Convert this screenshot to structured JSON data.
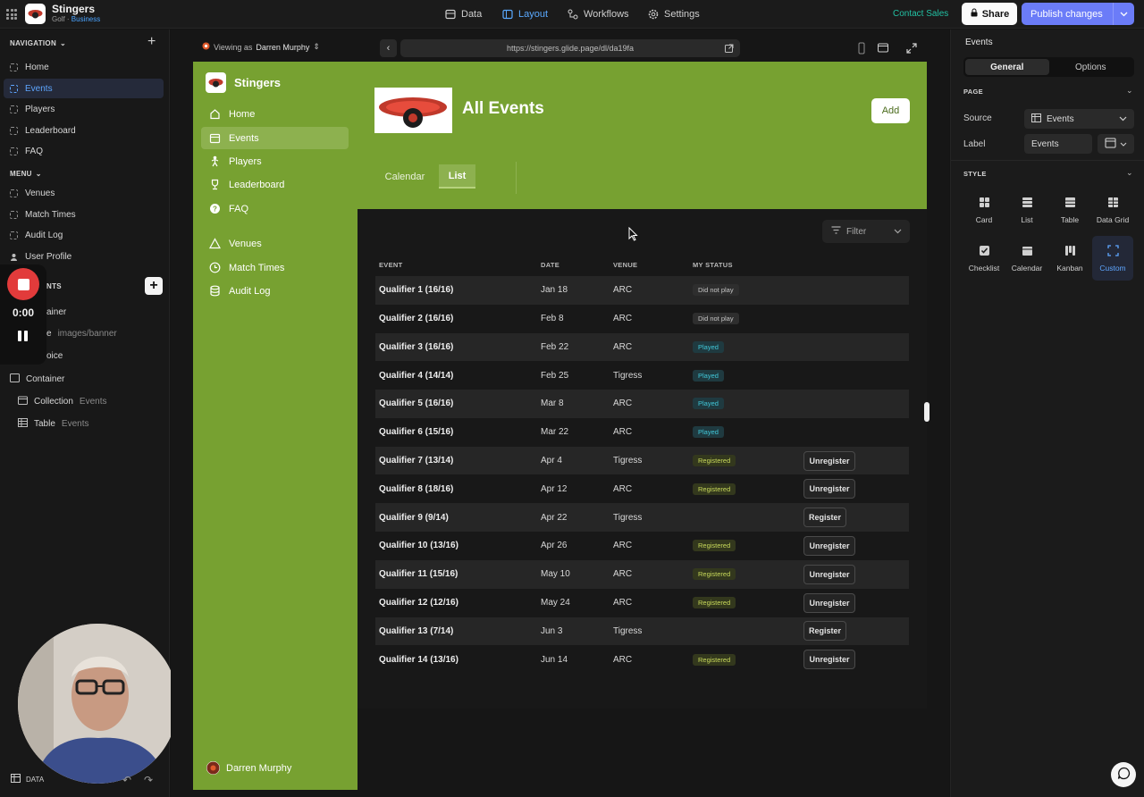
{
  "topbar": {
    "app_name": "Stingers",
    "app_sub": "Golf",
    "app_sub_sep": " · ",
    "app_tier": "Business",
    "nav": [
      {
        "label": "Data",
        "icon": "database-icon"
      },
      {
        "label": "Layout",
        "icon": "layout-icon",
        "active": true
      },
      {
        "label": "Workflows",
        "icon": "workflow-icon"
      },
      {
        "label": "Settings",
        "icon": "gear-icon"
      }
    ],
    "contact": "Contact Sales",
    "share": "Share",
    "publish": "Publish changes"
  },
  "left": {
    "navigation_title": "NAVIGATION",
    "navigation_items": [
      "Home",
      "Events",
      "Players",
      "Leaderboard",
      "FAQ"
    ],
    "selected": "Events",
    "menu_title": "MENU",
    "menu_items": [
      "Venues",
      "Match Times",
      "Audit Log",
      "User Profile"
    ],
    "components_title": "NTS",
    "components": [
      {
        "label": "ainer",
        "sub": ""
      },
      {
        "label": "e",
        "sub": "images/banner"
      },
      {
        "label": "oice",
        "sub": ""
      },
      {
        "label": "Container",
        "sub": ""
      },
      {
        "label": "Collection",
        "sub": "Events"
      },
      {
        "label": "Table",
        "sub": "Events"
      }
    ],
    "recording_time": "0:00",
    "data_tab": "DATA"
  },
  "preview": {
    "viewing_as_prefix": "Viewing as",
    "viewing_as": "Darren Murphy",
    "url": "https://stingers.glide.page/dl/da19fa",
    "app_title": "Stingers",
    "side_links": [
      "Home",
      "Events",
      "Players",
      "Leaderboard",
      "FAQ",
      "Venues",
      "Match Times",
      "Audit Log"
    ],
    "user": "Darren Murphy",
    "page_title": "All Events",
    "add": "Add",
    "tabs": [
      "Calendar",
      "List"
    ],
    "filter": "Filter",
    "columns": [
      "EVENT",
      "DATE",
      "VENUE",
      "MY STATUS"
    ],
    "rows": [
      {
        "event": "Qualifier 1 (16/16)",
        "date": "Jan 18",
        "venue": "ARC",
        "status": "Did not play",
        "action": ""
      },
      {
        "event": "Qualifier 2 (16/16)",
        "date": "Feb 8",
        "venue": "ARC",
        "status": "Did not play",
        "action": ""
      },
      {
        "event": "Qualifier 3 (16/16)",
        "date": "Feb 22",
        "venue": "ARC",
        "status": "Played",
        "action": ""
      },
      {
        "event": "Qualifier 4 (14/14)",
        "date": "Feb 25",
        "venue": "Tigress",
        "status": "Played",
        "action": ""
      },
      {
        "event": "Qualifier 5 (16/16)",
        "date": "Mar 8",
        "venue": "ARC",
        "status": "Played",
        "action": ""
      },
      {
        "event": "Qualifier 6 (15/16)",
        "date": "Mar 22",
        "venue": "ARC",
        "status": "Played",
        "action": ""
      },
      {
        "event": "Qualifier 7 (13/14)",
        "date": "Apr 4",
        "venue": "Tigress",
        "status": "Registered",
        "action": "Unregister"
      },
      {
        "event": "Qualifier 8 (18/16)",
        "date": "Apr 12",
        "venue": "ARC",
        "status": "Registered",
        "action": "Unregister"
      },
      {
        "event": "Qualifier 9 (9/14)",
        "date": "Apr 22",
        "venue": "Tigress",
        "status": "",
        "action": "Register"
      },
      {
        "event": "Qualifier 10 (13/16)",
        "date": "Apr 26",
        "venue": "ARC",
        "status": "Registered",
        "action": "Unregister"
      },
      {
        "event": "Qualifier 11 (15/16)",
        "date": "May 10",
        "venue": "ARC",
        "status": "Registered",
        "action": "Unregister"
      },
      {
        "event": "Qualifier 12 (12/16)",
        "date": "May 24",
        "venue": "ARC",
        "status": "Registered",
        "action": "Unregister"
      },
      {
        "event": "Qualifier 13 (7/14)",
        "date": "Jun 3",
        "venue": "Tigress",
        "status": "",
        "action": "Register"
      },
      {
        "event": "Qualifier 14 (13/16)",
        "date": "Jun 14",
        "venue": "ARC",
        "status": "Registered",
        "action": "Unregister"
      }
    ]
  },
  "right": {
    "title": "Events",
    "tabs": [
      "General",
      "Options"
    ],
    "page_section": "PAGE",
    "source_label": "Source",
    "source_value": "Events",
    "label_label": "Label",
    "label_value": "Events",
    "style_section": "STYLE",
    "styles": [
      "Card",
      "List",
      "Table",
      "Data Grid",
      "Checklist",
      "Calendar",
      "Kanban",
      "Custom"
    ],
    "style_selected": "Custom"
  },
  "colors": {
    "accent": "#6b7cf8",
    "app_green": "#77a131",
    "selected_blue": "#5ea6ff",
    "played": "#41c7d8",
    "registered": "#c8d95a"
  }
}
